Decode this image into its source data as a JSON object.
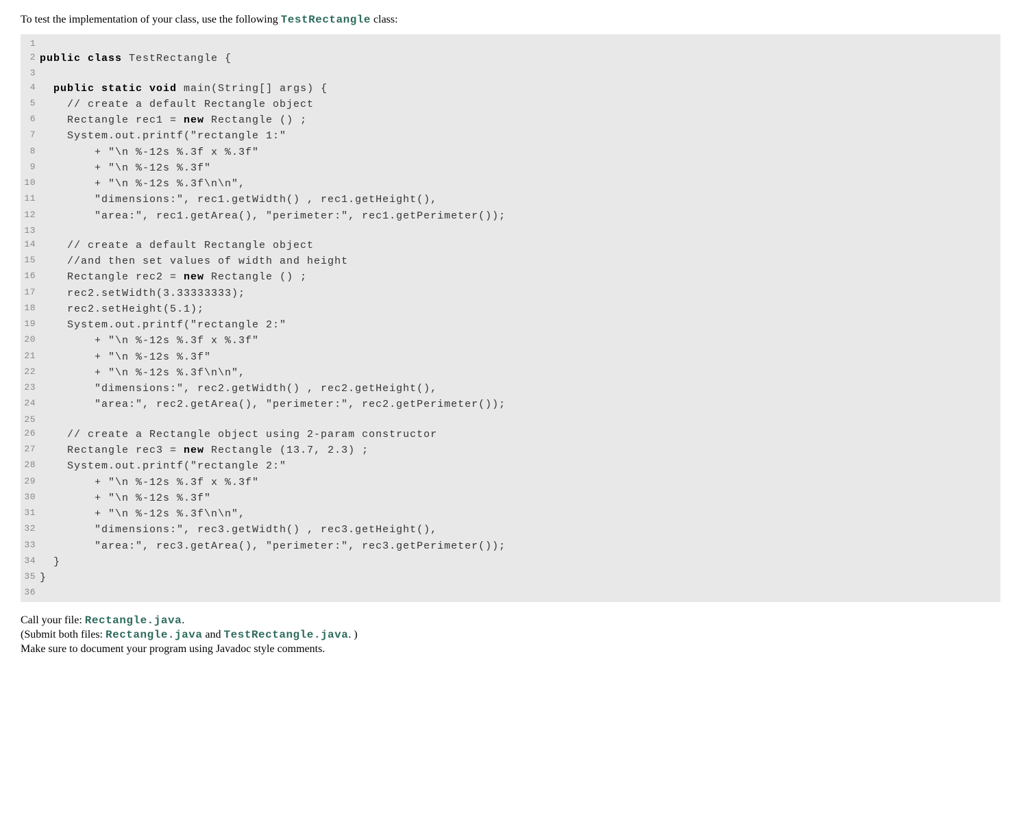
{
  "intro": {
    "prefix": "To test the implementation of your class, use the following ",
    "classname": "TestRectangle",
    "suffix": " class:"
  },
  "code": {
    "lines": [
      {
        "n": "1",
        "t": ""
      },
      {
        "n": "2",
        "t": "<span class='kw'>public class</span> TestRectangle {"
      },
      {
        "n": "3",
        "t": ""
      },
      {
        "n": "4",
        "t": "  <span class='kw'>public static void</span> main(String[] args) {"
      },
      {
        "n": "5",
        "t": "    // create a default Rectangle object"
      },
      {
        "n": "6",
        "t": "    Rectangle rec1 = <span class='kw'>new</span> Rectangle () ;"
      },
      {
        "n": "7",
        "t": "    System.out.printf(\"rectangle 1:\""
      },
      {
        "n": "8",
        "t": "        + \"\\n %-12s %.3f x %.3f\""
      },
      {
        "n": "9",
        "t": "        + \"\\n %-12s %.3f\""
      },
      {
        "n": "10",
        "t": "        + \"\\n %-12s %.3f\\n\\n\","
      },
      {
        "n": "11",
        "t": "        \"dimensions:\", rec1.getWidth() , rec1.getHeight(),"
      },
      {
        "n": "12",
        "t": "        \"area:\", rec1.getArea(), \"perimeter:\", rec1.getPerimeter());"
      },
      {
        "n": "13",
        "t": ""
      },
      {
        "n": "14",
        "t": "    // create a default Rectangle object"
      },
      {
        "n": "15",
        "t": "    //and then set values of width and height"
      },
      {
        "n": "16",
        "t": "    Rectangle rec2 = <span class='kw'>new</span> Rectangle () ;"
      },
      {
        "n": "17",
        "t": "    rec2.setWidth(3.33333333);"
      },
      {
        "n": "18",
        "t": "    rec2.setHeight(5.1);"
      },
      {
        "n": "19",
        "t": "    System.out.printf(\"rectangle 2:\""
      },
      {
        "n": "20",
        "t": "        + \"\\n %-12s %.3f x %.3f\""
      },
      {
        "n": "21",
        "t": "        + \"\\n %-12s %.3f\""
      },
      {
        "n": "22",
        "t": "        + \"\\n %-12s %.3f\\n\\n\","
      },
      {
        "n": "23",
        "t": "        \"dimensions:\", rec2.getWidth() , rec2.getHeight(),"
      },
      {
        "n": "24",
        "t": "        \"area:\", rec2.getArea(), \"perimeter:\", rec2.getPerimeter());"
      },
      {
        "n": "25",
        "t": ""
      },
      {
        "n": "26",
        "t": "    // create a Rectangle object using 2-param constructor"
      },
      {
        "n": "27",
        "t": "    Rectangle rec3 = <span class='kw'>new</span> Rectangle (13.7, 2.3) ;"
      },
      {
        "n": "28",
        "t": "    System.out.printf(\"rectangle 2:\""
      },
      {
        "n": "29",
        "t": "        + \"\\n %-12s %.3f x %.3f\""
      },
      {
        "n": "30",
        "t": "        + \"\\n %-12s %.3f\""
      },
      {
        "n": "31",
        "t": "        + \"\\n %-12s %.3f\\n\\n\","
      },
      {
        "n": "32",
        "t": "        \"dimensions:\", rec3.getWidth() , rec3.getHeight(),"
      },
      {
        "n": "33",
        "t": "        \"area:\", rec3.getArea(), \"perimeter:\", rec3.getPerimeter());"
      },
      {
        "n": "34",
        "t": "  }"
      },
      {
        "n": "35",
        "t": "}"
      },
      {
        "n": "36",
        "t": ""
      }
    ]
  },
  "outro": {
    "line1_prefix": "Call your file: ",
    "line1_file": "Rectangle.java",
    "line1_suffix": ".",
    "line2_prefix": "(Submit both files: ",
    "line2_file1": "Rectangle.java",
    "line2_mid": " and ",
    "line2_file2": "TestRectangle.java",
    "line2_suffix": ". )",
    "line3": "Make sure to document your program using Javadoc style comments."
  }
}
